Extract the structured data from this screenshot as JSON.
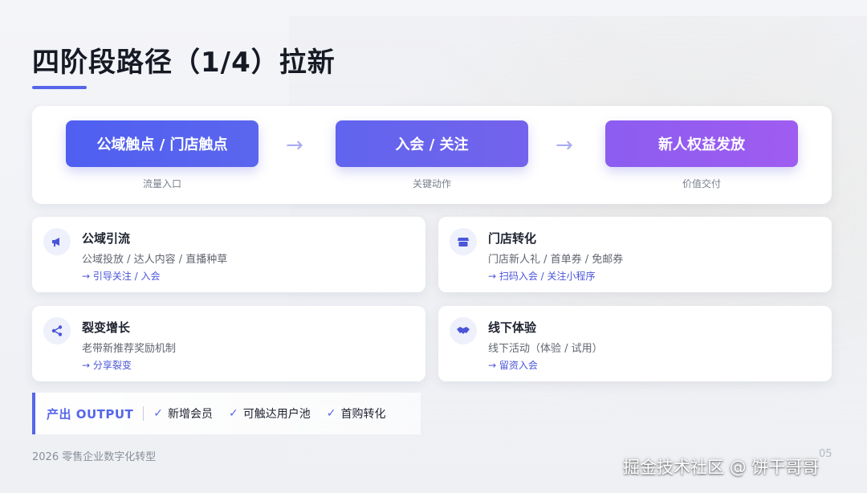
{
  "title": "四阶段路径（1/4）拉新",
  "flow": {
    "steps": [
      {
        "label": "公域触点 / 门店触点",
        "caption": "流量入口"
      },
      {
        "label": "入会 / 关注",
        "caption": "关键动作"
      },
      {
        "label": "新人权益发放",
        "caption": "价值交付"
      }
    ],
    "arrow": "→"
  },
  "cards": [
    {
      "icon": "megaphone-icon",
      "title": "公域引流",
      "sub": "公域投放 / 达人内容 / 直播种草",
      "link": "→ 引导关注 / 入会"
    },
    {
      "icon": "store-icon",
      "title": "门店转化",
      "sub": "门店新人礼 / 首单券 / 免邮券",
      "link": "→ 扫码入会 / 关注小程序"
    },
    {
      "icon": "share-icon",
      "title": "裂变增长",
      "sub": "老带新推荐奖励机制",
      "link": "→ 分享裂变"
    },
    {
      "icon": "handshake-icon",
      "title": "线下体验",
      "sub": "线下活动（体验 / 试用）",
      "link": "→ 留资入会"
    }
  ],
  "output": {
    "label": "产出 OUTPUT",
    "items": [
      "新增会员",
      "可触达用户池",
      "首购转化"
    ],
    "check": "✓"
  },
  "footer": "2026 零售企业数字化转型",
  "page_number": "05",
  "watermark": "掘金技术社区 @ 饼干哥哥",
  "colors": {
    "accent": "#5566ea",
    "step1": "#5563ee",
    "step2": "#6f63ee",
    "step3": "#9b5cf0"
  }
}
